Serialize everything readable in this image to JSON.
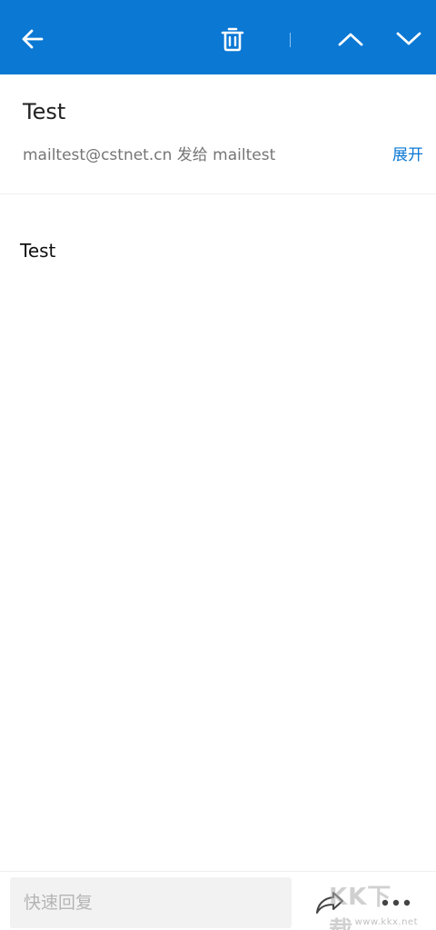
{
  "toolbar": {
    "back_icon": "arrow-left-icon",
    "delete_icon": "trash-icon",
    "prev_icon": "chevron-up-icon",
    "next_icon": "chevron-down-icon",
    "background_color": "#0b78d4",
    "icon_color": "#ffffff"
  },
  "message": {
    "subject": "Test",
    "meta": "mailtest@cstnet.cn 发给 mailtest",
    "expand_label": "展开",
    "body": "Test"
  },
  "bottom_bar": {
    "quick_reply_placeholder": "快速回复",
    "forward_icon": "forward-icon",
    "more_icon": "more-dots-icon"
  },
  "watermark": {
    "logo": "KK下载",
    "url": "www.kkx.net"
  },
  "colors": {
    "accent": "#0b78d4",
    "subject_text": "#222222",
    "meta_text": "#757575"
  }
}
